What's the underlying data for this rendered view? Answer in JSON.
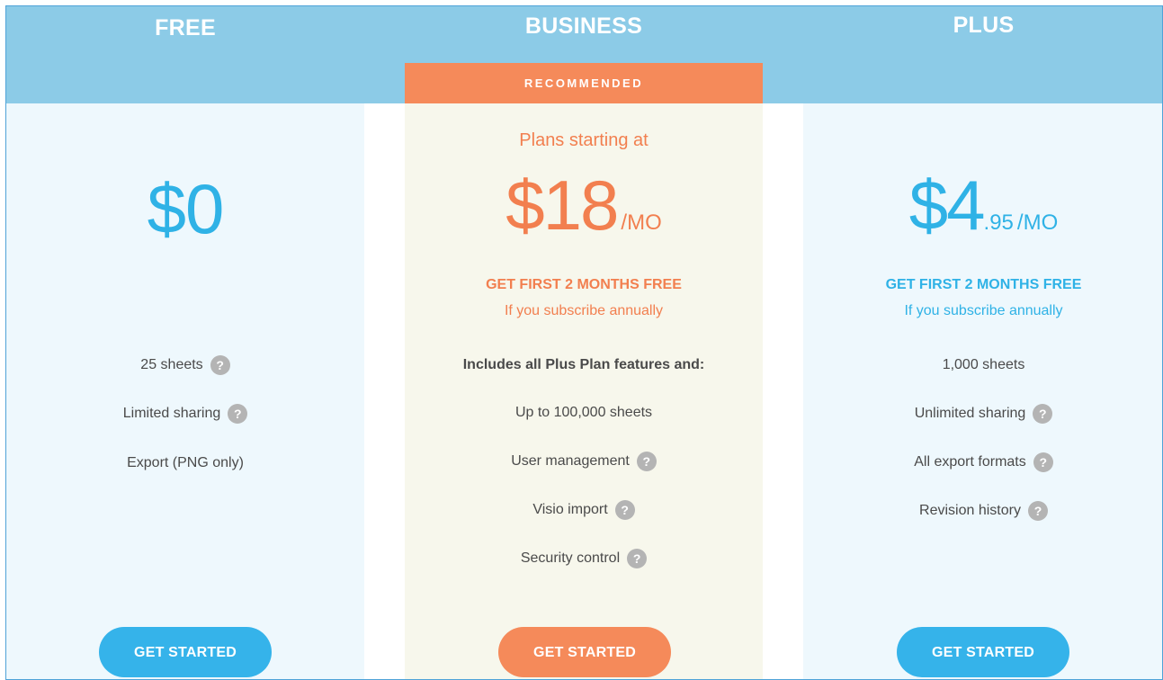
{
  "plans": {
    "free": {
      "name": "FREE",
      "price": "$0",
      "features": [
        {
          "label": "25 sheets",
          "help": true
        },
        {
          "label": "Limited sharing",
          "help": true
        },
        {
          "label": "Export (PNG only)",
          "help": false
        }
      ],
      "cta": "GET STARTED"
    },
    "business": {
      "name": "BUSINESS",
      "badge": "RECOMMENDED",
      "starting_text": "Plans starting at",
      "price_main": "$18",
      "price_period": "/MO",
      "promo_title": "GET FIRST 2 MONTHS FREE",
      "promo_sub": "If you subscribe annually",
      "features_intro": "Includes all Plus Plan features and:",
      "features": [
        {
          "label": "Up to 100,000 sheets",
          "help": false
        },
        {
          "label": "User management",
          "help": true
        },
        {
          "label": "Visio import",
          "help": true
        },
        {
          "label": "Security control",
          "help": true
        }
      ],
      "cta": "GET STARTED"
    },
    "plus": {
      "name": "PLUS",
      "price_main": "$4",
      "price_cents": ".95",
      "price_period": "/MO",
      "promo_title": "GET FIRST 2 MONTHS FREE",
      "promo_sub": "If you subscribe annually",
      "features": [
        {
          "label": "1,000 sheets",
          "help": false
        },
        {
          "label": "Unlimited sharing",
          "help": true
        },
        {
          "label": "All export formats",
          "help": true
        },
        {
          "label": "Revision history",
          "help": true
        }
      ],
      "cta": "GET STARTED"
    }
  },
  "help_glyph": "?",
  "colors": {
    "header": "#8ccbe7",
    "blue_accent": "#2fb2e6",
    "orange_accent": "#f27f4f",
    "free_plus_bg": "#eef8fd",
    "business_bg": "#f7f7ec",
    "help_icon": "#b4b4b4"
  }
}
